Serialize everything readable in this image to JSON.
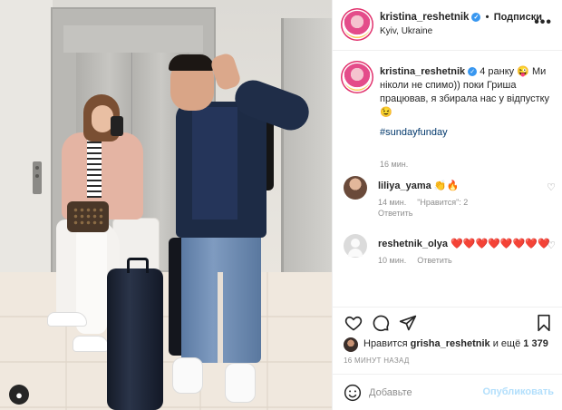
{
  "header": {
    "username": "kristina_reshetnik",
    "separator": "•",
    "follow_label": "Подписки",
    "location": "Kyiv, Ukraine",
    "more_label": "•••"
  },
  "caption": {
    "username": "kristina_reshetnik",
    "text": "4 ранку 😜 Ми ніколи не спимо)) поки Гриша працював, я збирала нас у відпустку 😉",
    "hashtag": "#sundayfunday",
    "time": "16 мин."
  },
  "comments": [
    {
      "username": "liliya_yama",
      "text": "👏🔥",
      "time": "14 мин.",
      "likes": "\"Нравится\": 2",
      "reply": "Ответить",
      "heart": "♡"
    },
    {
      "username": "reshetnik_olya",
      "text": "❤️❤️❤️❤️❤️❤️❤️❤️",
      "time": "10 мин.",
      "reply": "Ответить",
      "heart": "♡"
    }
  ],
  "likes": {
    "prefix": "Нравится",
    "user": "grisha_reshetnik",
    "middle": "и ещё",
    "count": "1 379"
  },
  "timestamp": "16 МИНУТ НАЗАД",
  "add_comment": {
    "placeholder": "Добавьте",
    "publish_label": "Опубликовать"
  },
  "icons": {
    "like": "heart-icon",
    "comment": "comment-icon",
    "share": "share-icon",
    "save": "bookmark-icon",
    "emoji": "emoji-icon",
    "user_tag": "user-tag-icon"
  },
  "colors": {
    "verified": "#3897f0",
    "hashtag": "#00376b",
    "muted": "#8e8e8e",
    "publish_disabled": "#b2dffc"
  }
}
